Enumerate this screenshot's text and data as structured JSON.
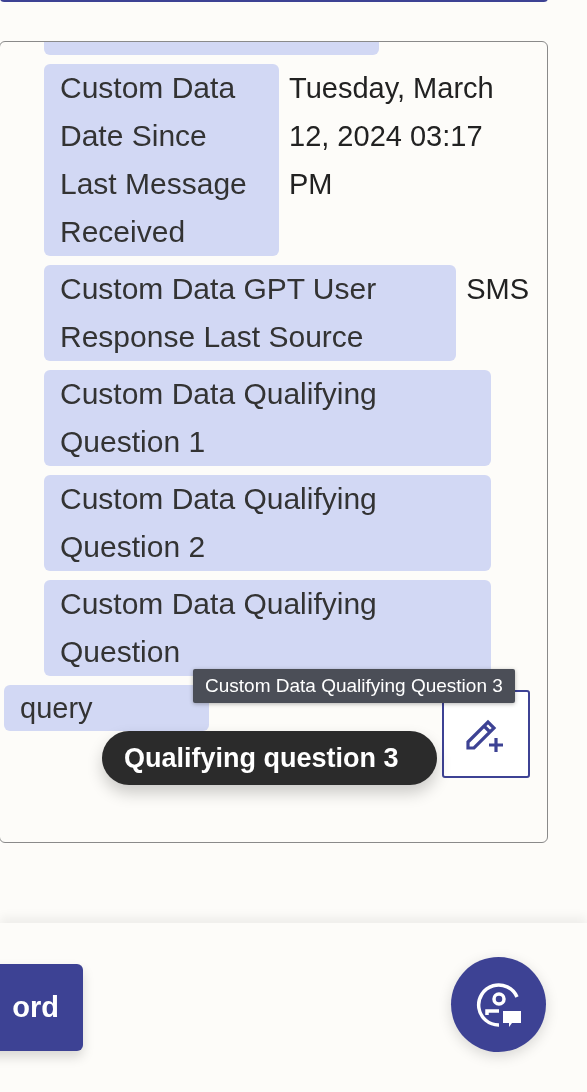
{
  "fields": [
    {
      "label": "Custom Data Date Since Last Message Received",
      "value": "Tuesday, March 12, 2024 03:17 PM"
    },
    {
      "label": "Custom Data GPT User Response Last Source",
      "value": "SMS"
    },
    {
      "label": "Custom Data Qualifying Question 1"
    },
    {
      "label": "Custom Data Qualifying Question 2"
    },
    {
      "label": "Custom Data Qualifying Question"
    }
  ],
  "extra_tag": {
    "label": "query"
  },
  "tooltip": {
    "text": "Custom Data Qualifying Question 3"
  },
  "toast": {
    "text": "Qualifying question 3"
  },
  "footer": {
    "button": "ord"
  }
}
